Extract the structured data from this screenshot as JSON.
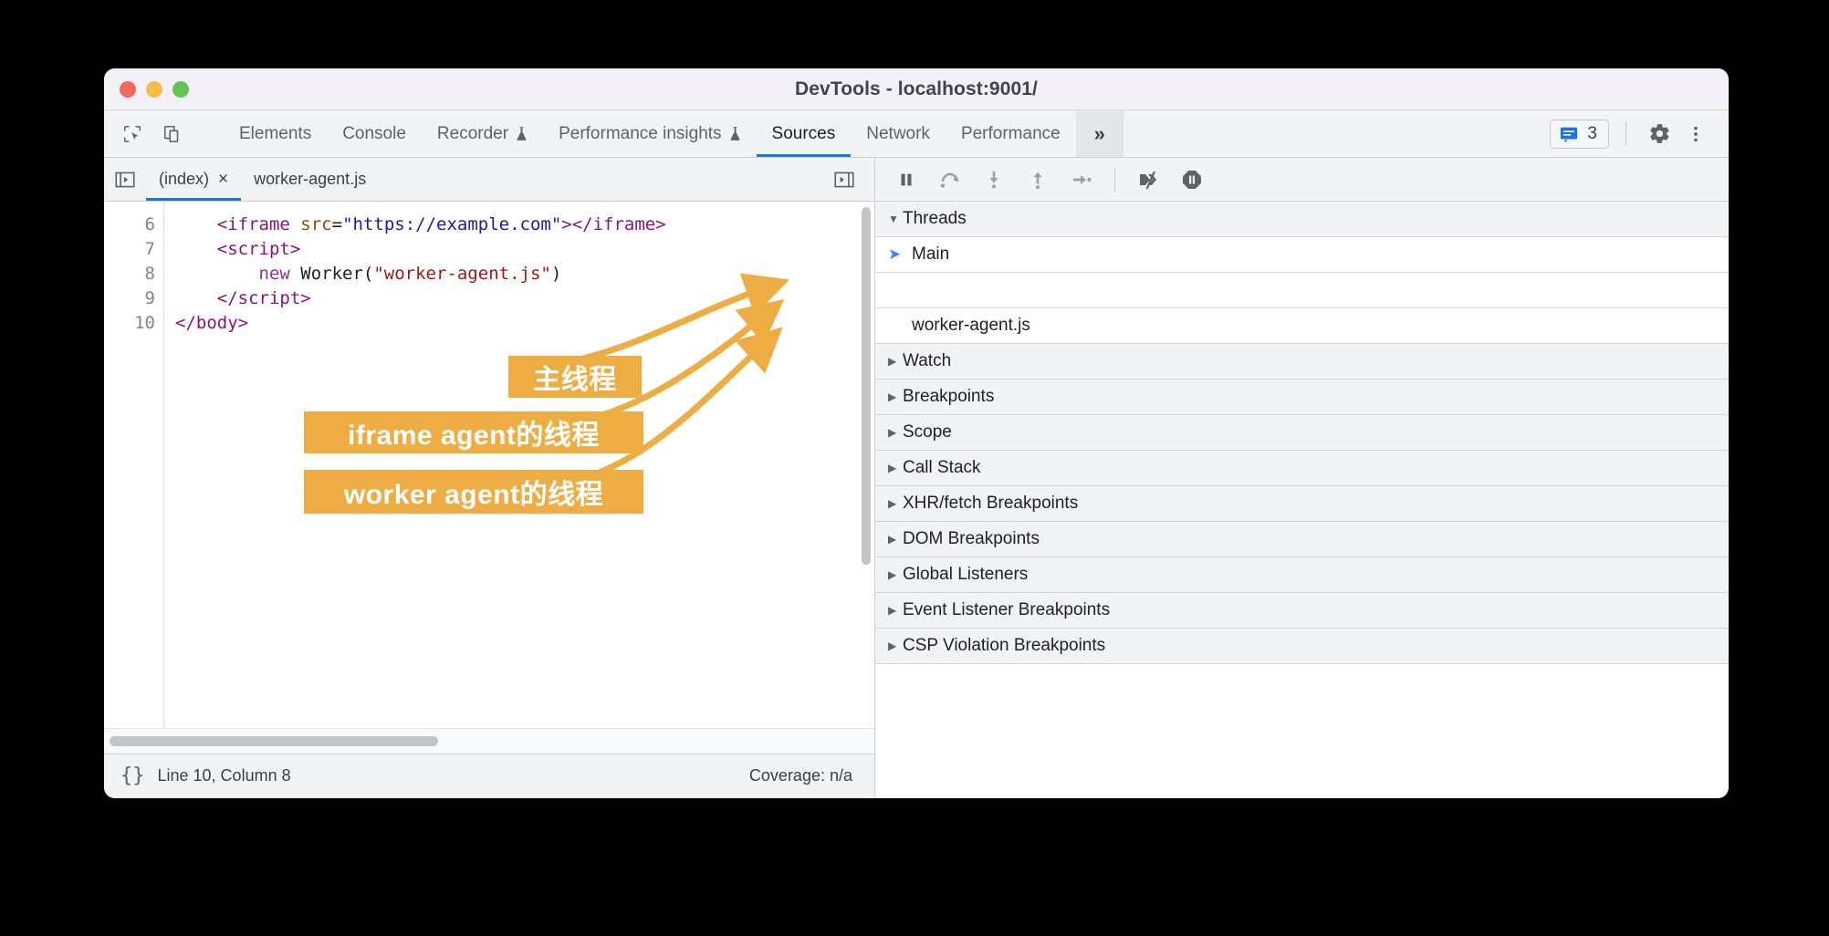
{
  "window": {
    "title": "DevTools - localhost:9001/",
    "traffic_lights": [
      "close",
      "minimize",
      "maximize"
    ]
  },
  "toolbar": {
    "inspect_icon": "inspect-element-icon",
    "device_icon": "device-toolbar-icon",
    "tabs": [
      {
        "label": "Elements",
        "active": false,
        "experimental": false
      },
      {
        "label": "Console",
        "active": false,
        "experimental": false
      },
      {
        "label": "Recorder",
        "active": false,
        "experimental": true
      },
      {
        "label": "Performance insights",
        "active": false,
        "experimental": true
      },
      {
        "label": "Sources",
        "active": true,
        "experimental": false
      },
      {
        "label": "Network",
        "active": false,
        "experimental": false
      },
      {
        "label": "Performance",
        "active": false,
        "experimental": false
      }
    ],
    "overflow_label": "»",
    "messages": {
      "icon": "message-icon",
      "count": "3"
    },
    "settings_icon": "gear-icon",
    "more_icon": "more-vertical-icon",
    "accent_color": "#1a73e8"
  },
  "file_tabs": {
    "navigator_toggle_icon": "show-navigator-icon",
    "debugger_toggle_icon": "show-debugger-icon",
    "tabs": [
      {
        "label": "(index)",
        "active": true,
        "closable": true,
        "close_glyph": "×"
      },
      {
        "label": "worker-agent.js",
        "active": false,
        "closable": false,
        "close_glyph": ""
      }
    ]
  },
  "editor": {
    "lines": [
      {
        "number": "6",
        "tokens": [
          {
            "t": "    ",
            "c": "plain"
          },
          {
            "t": "<iframe ",
            "c": "tag"
          },
          {
            "t": "src",
            "c": "attr"
          },
          {
            "t": "=",
            "c": "plain"
          },
          {
            "t": "\"https://example.com\"",
            "c": "val"
          },
          {
            "t": "></iframe>",
            "c": "tag"
          }
        ]
      },
      {
        "number": "7",
        "tokens": [
          {
            "t": "    ",
            "c": "plain"
          },
          {
            "t": "<script>",
            "c": "tag"
          }
        ]
      },
      {
        "number": "8",
        "tokens": [
          {
            "t": "        ",
            "c": "plain"
          },
          {
            "t": "new",
            "c": "kw"
          },
          {
            "t": " Worker(",
            "c": "plain"
          },
          {
            "t": "\"worker-agent.js\"",
            "c": "str"
          },
          {
            "t": ")",
            "c": "plain"
          }
        ]
      },
      {
        "number": "9",
        "tokens": [
          {
            "t": "    ",
            "c": "plain"
          },
          {
            "t": "</script>",
            "c": "tag"
          }
        ]
      },
      {
        "number": "10",
        "tokens": [
          {
            "t": "</body>",
            "c": "tag"
          }
        ]
      }
    ]
  },
  "status_bar": {
    "format_icon": "pretty-print-braces-icon",
    "cursor_position": "Line 10, Column 8",
    "coverage": "Coverage: n/a"
  },
  "debugger_toolbar": {
    "buttons": [
      {
        "name": "pause-script-icon",
        "title": "Pause script execution"
      },
      {
        "name": "step-over-icon",
        "title": "Step over next function call"
      },
      {
        "name": "step-into-icon",
        "title": "Step into next function call"
      },
      {
        "name": "step-out-icon",
        "title": "Step out of current function"
      },
      {
        "name": "step-icon",
        "title": "Step"
      },
      {
        "name": "deactivate-breakpoints-icon",
        "title": "Deactivate breakpoints"
      },
      {
        "name": "pause-on-exceptions-icon",
        "title": "Pause on exceptions"
      }
    ]
  },
  "side_panel": {
    "threads": {
      "label": "Threads",
      "expanded": true,
      "items": [
        {
          "label": "Main",
          "selected": true,
          "marker": "➤"
        },
        {
          "label": "",
          "selected": false,
          "marker": ""
        },
        {
          "label": "worker-agent.js",
          "selected": false,
          "marker": ""
        }
      ]
    },
    "sections": [
      {
        "label": "Watch",
        "expanded": false
      },
      {
        "label": "Breakpoints",
        "expanded": false
      },
      {
        "label": "Scope",
        "expanded": false
      },
      {
        "label": "Call Stack",
        "expanded": false
      },
      {
        "label": "XHR/fetch Breakpoints",
        "expanded": false
      },
      {
        "label": "DOM Breakpoints",
        "expanded": false
      },
      {
        "label": "Global Listeners",
        "expanded": false
      },
      {
        "label": "Event Listener Breakpoints",
        "expanded": false
      },
      {
        "label": "CSP Violation Breakpoints",
        "expanded": false
      }
    ]
  },
  "annotations": {
    "color": "#eead43",
    "labels": [
      {
        "text": "主线程",
        "points_to": "Main"
      },
      {
        "text": "iframe agent的线程",
        "points_to": "iframe-thread-row"
      },
      {
        "text": "worker agent的线程",
        "points_to": "worker-agent.js"
      }
    ]
  }
}
